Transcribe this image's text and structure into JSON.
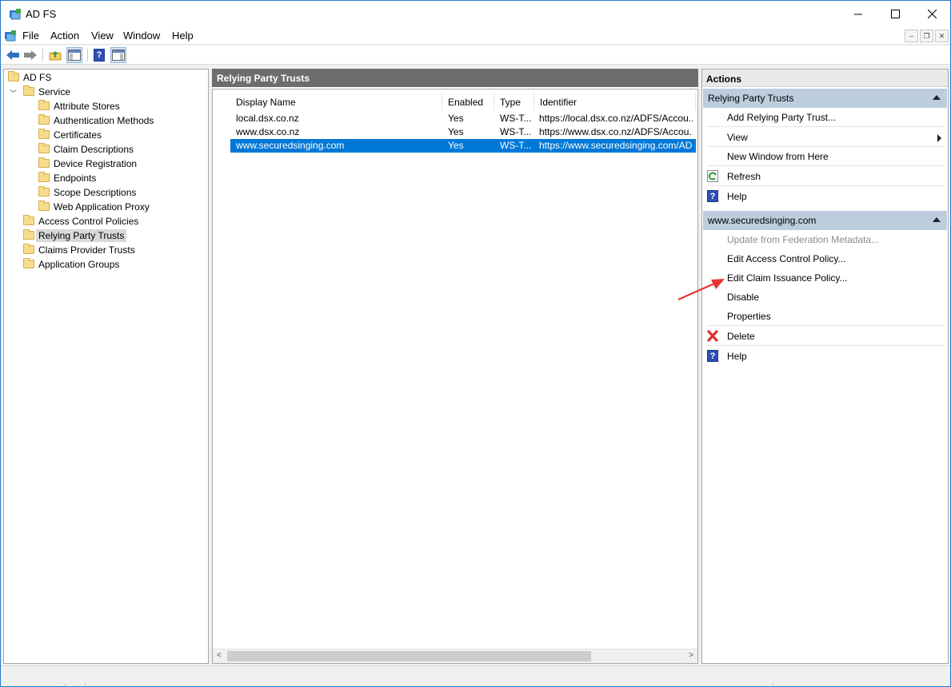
{
  "window": {
    "title": "AD FS"
  },
  "menu": {
    "items": [
      "File",
      "Action",
      "View",
      "Window",
      "Help"
    ]
  },
  "toolbar": {
    "icons": [
      "back-icon",
      "forward-icon",
      "up-folder-icon",
      "show-hide-tree-icon",
      "help-icon",
      "show-hide-action-pane-icon"
    ]
  },
  "tree": {
    "root": "AD FS",
    "service": "Service",
    "service_children": [
      "Attribute Stores",
      "Authentication Methods",
      "Certificates",
      "Claim Descriptions",
      "Device Registration",
      "Endpoints",
      "Scope Descriptions",
      "Web Application Proxy"
    ],
    "top_nodes": [
      "Access Control Policies",
      "Relying Party Trusts",
      "Claims Provider Trusts",
      "Application Groups"
    ],
    "selected": "Relying Party Trusts"
  },
  "center": {
    "header": "Relying Party Trusts",
    "columns": [
      "Display Name",
      "Enabled",
      "Type",
      "Identifier"
    ],
    "rows": [
      {
        "name": "local.dsx.co.nz",
        "enabled": "Yes",
        "type": "WS-T...",
        "identifier": "https://local.dsx.co.nz/ADFS/Accou..."
      },
      {
        "name": "www.dsx.co.nz",
        "enabled": "Yes",
        "type": "WS-T...",
        "identifier": "https://www.dsx.co.nz/ADFS/Accou..."
      },
      {
        "name": "www.securedsinging.com",
        "enabled": "Yes",
        "type": "WS-T...",
        "identifier": "https://www.securedsinging.com/AD..."
      }
    ],
    "selected_row": 2
  },
  "actions": {
    "title": "Actions",
    "section1": {
      "header": "Relying Party Trusts",
      "items": [
        "Add Relying Party Trust...",
        "View",
        "New Window from Here",
        "Refresh",
        "Help"
      ]
    },
    "section2": {
      "header": "www.securedsinging.com",
      "items": [
        "Update from Federation Metadata...",
        "Edit Access Control Policy...",
        "Edit Claim Issuance Policy...",
        "Disable",
        "Properties",
        "Delete",
        "Help"
      ]
    }
  },
  "annotation": {
    "arrow_color": "#e8352f"
  }
}
